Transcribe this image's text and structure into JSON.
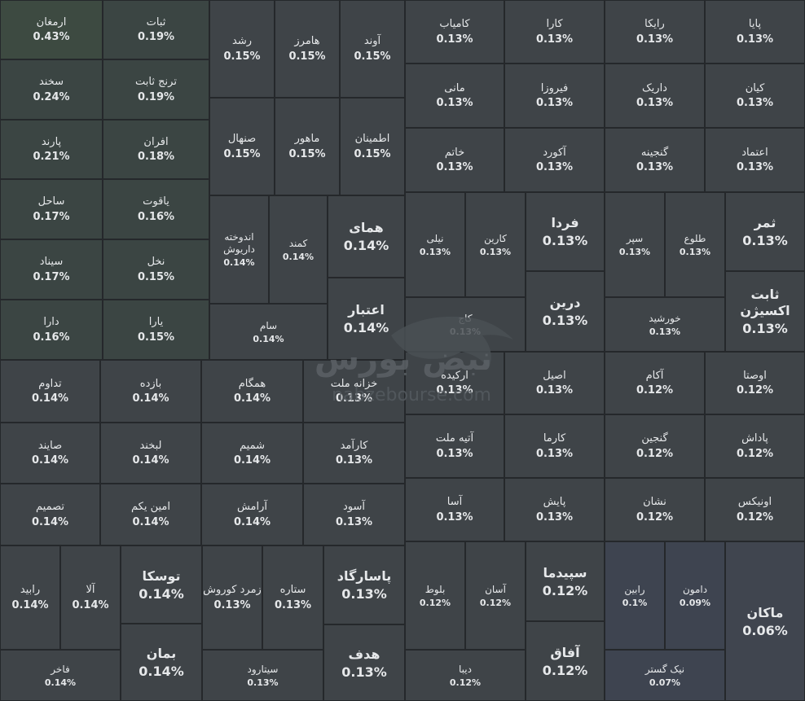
{
  "chart_data": {
    "type": "treemap",
    "colors": {
      "background": "#2f3336",
      "border": "#25282b",
      "text": "#e6e8ea",
      "tile_default": "#3f4448",
      "tile_top": "#3d4a41",
      "tile_mid": "#3b4543",
      "tile_low": "#3e4450",
      "tile_lowest": "#40454f"
    },
    "watermark": {
      "logo_text": "نبض بورس",
      "url_text": "nabzebourse.com"
    },
    "cells": [
      {
        "name": "ارمغان",
        "value": "0.43%",
        "tone": "top",
        "size": "m"
      },
      {
        "name": "ثبات",
        "value": "0.19%",
        "tone": "mid",
        "size": "m"
      },
      {
        "name": "سخند",
        "value": "0.24%",
        "tone": "mid",
        "size": "m"
      },
      {
        "name": "ترنج ثابت",
        "value": "0.19%",
        "tone": "mid",
        "size": "m"
      },
      {
        "name": "پارند",
        "value": "0.21%",
        "tone": "mid",
        "size": "m"
      },
      {
        "name": "افران",
        "value": "0.18%",
        "tone": "mid",
        "size": "m"
      },
      {
        "name": "ساحل",
        "value": "0.17%",
        "tone": "mid",
        "size": "m"
      },
      {
        "name": "یاقوت",
        "value": "0.16%",
        "tone": "mid",
        "size": "m"
      },
      {
        "name": "سیناد",
        "value": "0.17%",
        "tone": "mid",
        "size": "m"
      },
      {
        "name": "نخل",
        "value": "0.15%",
        "tone": "mid",
        "size": "m"
      },
      {
        "name": "دارا",
        "value": "0.16%",
        "tone": "mid",
        "size": "m"
      },
      {
        "name": "یارا",
        "value": "0.15%",
        "tone": "mid",
        "size": "m"
      },
      {
        "name": "رشد",
        "value": "0.15%",
        "tone": "default",
        "size": "m"
      },
      {
        "name": "هامرز",
        "value": "0.15%",
        "tone": "default",
        "size": "m"
      },
      {
        "name": "آوند",
        "value": "0.15%",
        "tone": "default",
        "size": "m"
      },
      {
        "name": "صنهال",
        "value": "0.15%",
        "tone": "default",
        "size": "m"
      },
      {
        "name": "ماهور",
        "value": "0.15%",
        "tone": "default",
        "size": "m"
      },
      {
        "name": "اطمینان",
        "value": "0.15%",
        "tone": "default",
        "size": "m"
      },
      {
        "name": "اندوخته داریوش",
        "value": "0.14%",
        "tone": "default",
        "size": "s"
      },
      {
        "name": "کمند",
        "value": "0.14%",
        "tone": "default",
        "size": "s"
      },
      {
        "name": "همای",
        "value": "0.14%",
        "tone": "default",
        "size": "l"
      },
      {
        "name": "اعتبار",
        "value": "0.14%",
        "tone": "default",
        "size": "l"
      },
      {
        "name": "سام",
        "value": "0.14%",
        "tone": "default",
        "size": "s"
      },
      {
        "name": "تداوم",
        "value": "0.14%",
        "tone": "default",
        "size": "m"
      },
      {
        "name": "بازده",
        "value": "0.14%",
        "tone": "default",
        "size": "m"
      },
      {
        "name": "همگام",
        "value": "0.14%",
        "tone": "default",
        "size": "m"
      },
      {
        "name": "خزانه ملت",
        "value": "0.13%",
        "tone": "default",
        "size": "m"
      },
      {
        "name": "صایند",
        "value": "0.14%",
        "tone": "default",
        "size": "m"
      },
      {
        "name": "لبخند",
        "value": "0.14%",
        "tone": "default",
        "size": "m"
      },
      {
        "name": "شمیم",
        "value": "0.14%",
        "tone": "default",
        "size": "m"
      },
      {
        "name": "کارآمد",
        "value": "0.13%",
        "tone": "default",
        "size": "m"
      },
      {
        "name": "تصمیم",
        "value": "0.14%",
        "tone": "default",
        "size": "m"
      },
      {
        "name": "امین یکم",
        "value": "0.14%",
        "tone": "default",
        "size": "m"
      },
      {
        "name": "آرامش",
        "value": "0.14%",
        "tone": "default",
        "size": "m"
      },
      {
        "name": "آسود",
        "value": "0.13%",
        "tone": "default",
        "size": "m"
      },
      {
        "name": "رابید",
        "value": "0.14%",
        "tone": "default",
        "size": "m"
      },
      {
        "name": "آلا",
        "value": "0.14%",
        "tone": "default",
        "size": "m"
      },
      {
        "name": "توسکا",
        "value": "0.14%",
        "tone": "default",
        "size": "l"
      },
      {
        "name": "زمرد کوروش",
        "value": "0.13%",
        "tone": "default",
        "size": "m"
      },
      {
        "name": "ستاره",
        "value": "0.13%",
        "tone": "default",
        "size": "m"
      },
      {
        "name": "پاسارگاد",
        "value": "0.13%",
        "tone": "default",
        "size": "l"
      },
      {
        "name": "فاخر",
        "value": "0.14%",
        "tone": "default",
        "size": "s"
      },
      {
        "name": "بمان",
        "value": "0.14%",
        "tone": "default",
        "size": "l"
      },
      {
        "name": "سیتارود",
        "value": "0.13%",
        "tone": "default",
        "size": "s"
      },
      {
        "name": "هدف",
        "value": "0.13%",
        "tone": "default",
        "size": "l"
      },
      {
        "name": "کامیاب",
        "value": "0.13%",
        "tone": "default",
        "size": "m"
      },
      {
        "name": "کارا",
        "value": "0.13%",
        "tone": "default",
        "size": "m"
      },
      {
        "name": "رایکا",
        "value": "0.13%",
        "tone": "default",
        "size": "m"
      },
      {
        "name": "پایا",
        "value": "0.13%",
        "tone": "default",
        "size": "m"
      },
      {
        "name": "مانی",
        "value": "0.13%",
        "tone": "default",
        "size": "m"
      },
      {
        "name": "فیروزا",
        "value": "0.13%",
        "tone": "default",
        "size": "m"
      },
      {
        "name": "داریک",
        "value": "0.13%",
        "tone": "default",
        "size": "m"
      },
      {
        "name": "کیان",
        "value": "0.13%",
        "tone": "default",
        "size": "m"
      },
      {
        "name": "خاتم",
        "value": "0.13%",
        "tone": "default",
        "size": "m"
      },
      {
        "name": "آکورد",
        "value": "0.13%",
        "tone": "default",
        "size": "m"
      },
      {
        "name": "گنجینه",
        "value": "0.13%",
        "tone": "default",
        "size": "m"
      },
      {
        "name": "اعتماد",
        "value": "0.13%",
        "tone": "default",
        "size": "m"
      },
      {
        "name": "نیلی",
        "value": "0.13%",
        "tone": "default",
        "size": "s"
      },
      {
        "name": "کارین",
        "value": "0.13%",
        "tone": "default",
        "size": "s"
      },
      {
        "name": "فردا",
        "value": "0.13%",
        "tone": "default",
        "size": "l"
      },
      {
        "name": "سپر",
        "value": "0.13%",
        "tone": "default",
        "size": "s"
      },
      {
        "name": "طلوع",
        "value": "0.13%",
        "tone": "default",
        "size": "s"
      },
      {
        "name": "ثمر",
        "value": "0.13%",
        "tone": "default",
        "size": "l"
      },
      {
        "name": "کاج",
        "value": "0.13%",
        "tone": "default",
        "size": "s"
      },
      {
        "name": "درین",
        "value": "0.13%",
        "tone": "default",
        "size": "l"
      },
      {
        "name": "خورشید",
        "value": "0.13%",
        "tone": "default",
        "size": "s"
      },
      {
        "name": "ثابت اکسیژن",
        "value": "0.13%",
        "tone": "default",
        "size": "l"
      },
      {
        "name": "ارکیده",
        "value": "0.13%",
        "tone": "default",
        "size": "m"
      },
      {
        "name": "اصیل",
        "value": "0.13%",
        "tone": "default",
        "size": "m"
      },
      {
        "name": "آکام",
        "value": "0.12%",
        "tone": "default",
        "size": "m"
      },
      {
        "name": "اوصتا",
        "value": "0.12%",
        "tone": "default",
        "size": "m"
      },
      {
        "name": "آتیه ملت",
        "value": "0.13%",
        "tone": "default",
        "size": "m"
      },
      {
        "name": "کارما",
        "value": "0.13%",
        "tone": "default",
        "size": "m"
      },
      {
        "name": "گنجین",
        "value": "0.12%",
        "tone": "default",
        "size": "m"
      },
      {
        "name": "پاداش",
        "value": "0.12%",
        "tone": "default",
        "size": "m"
      },
      {
        "name": "آسا",
        "value": "0.13%",
        "tone": "default",
        "size": "m"
      },
      {
        "name": "پایش",
        "value": "0.13%",
        "tone": "default",
        "size": "m"
      },
      {
        "name": "نشان",
        "value": "0.12%",
        "tone": "default",
        "size": "m"
      },
      {
        "name": "اونیکس",
        "value": "0.12%",
        "tone": "default",
        "size": "m"
      },
      {
        "name": "بلوط",
        "value": "0.12%",
        "tone": "default",
        "size": "s"
      },
      {
        "name": "آسان",
        "value": "0.12%",
        "tone": "default",
        "size": "s"
      },
      {
        "name": "سپیدما",
        "value": "0.12%",
        "tone": "default",
        "size": "l"
      },
      {
        "name": "رابین",
        "value": "0.1%",
        "tone": "low",
        "size": "s"
      },
      {
        "name": "دامون",
        "value": "0.09%",
        "tone": "low",
        "size": "s"
      },
      {
        "name": "ماکان",
        "value": "0.06%",
        "tone": "lowest",
        "size": "l"
      },
      {
        "name": "دیبا",
        "value": "0.12%",
        "tone": "default",
        "size": "s"
      },
      {
        "name": "آفاق",
        "value": "0.12%",
        "tone": "default",
        "size": "l"
      },
      {
        "name": "نیک گستر",
        "value": "0.07%",
        "tone": "low",
        "size": "s"
      }
    ]
  }
}
